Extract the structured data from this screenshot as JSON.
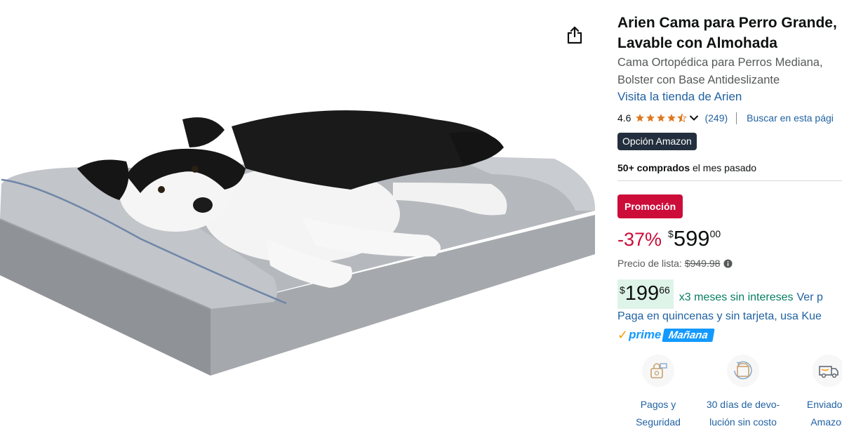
{
  "product": {
    "title_lines": [
      "Arien Cama para Perro Grande,",
      "Lavable con Almohada"
    ],
    "subtitle_lines": [
      "Cama Ortopédica para Perros Mediana,",
      "Bolster con Base Antideslizante"
    ],
    "store_link": "Visita la tienda de Arien",
    "image_icon": "dog-bed-photo",
    "share_icon": "share-icon"
  },
  "rating": {
    "value": "4.6",
    "stars": 4.5,
    "count": "(249)",
    "search_link": "Buscar en esta pági",
    "star_color": "#de7921"
  },
  "badges": {
    "choice": "Opción Amazon",
    "promo": "Promoción"
  },
  "bought": {
    "bold": "50+ comprados",
    "rest": " el mes pasado"
  },
  "price": {
    "discount": "-37%",
    "currency": "$",
    "whole": "599",
    "fraction": "00",
    "list_label": "Precio de lista:",
    "list_value": "$949.98"
  },
  "installments": {
    "currency": "$",
    "whole": "199",
    "fraction": "66",
    "text": "x3 meses sin intereses",
    "link": "Ver p"
  },
  "quincenas": "Paga en quincenas y sin tarjeta, usa Kue",
  "prime": {
    "logo": "prime",
    "delivery": "Mañana"
  },
  "features": [
    {
      "icon": "secure-payment-icon",
      "lines": [
        "Pagos y",
        "Seguridad"
      ]
    },
    {
      "icon": "returns-icon",
      "lines": [
        "30 días de devo-",
        "lución sin costo"
      ]
    },
    {
      "icon": "delivery-truck-icon",
      "lines": [
        "Enviado p",
        "Amazon"
      ]
    }
  ],
  "colors": {
    "link": "#2162a1",
    "promo_red": "#cc0c39",
    "installment_green": "#067d62",
    "installment_bg": "#dff4e9",
    "choice_bg": "#232f3e",
    "prime_blue": "#1399ff"
  }
}
